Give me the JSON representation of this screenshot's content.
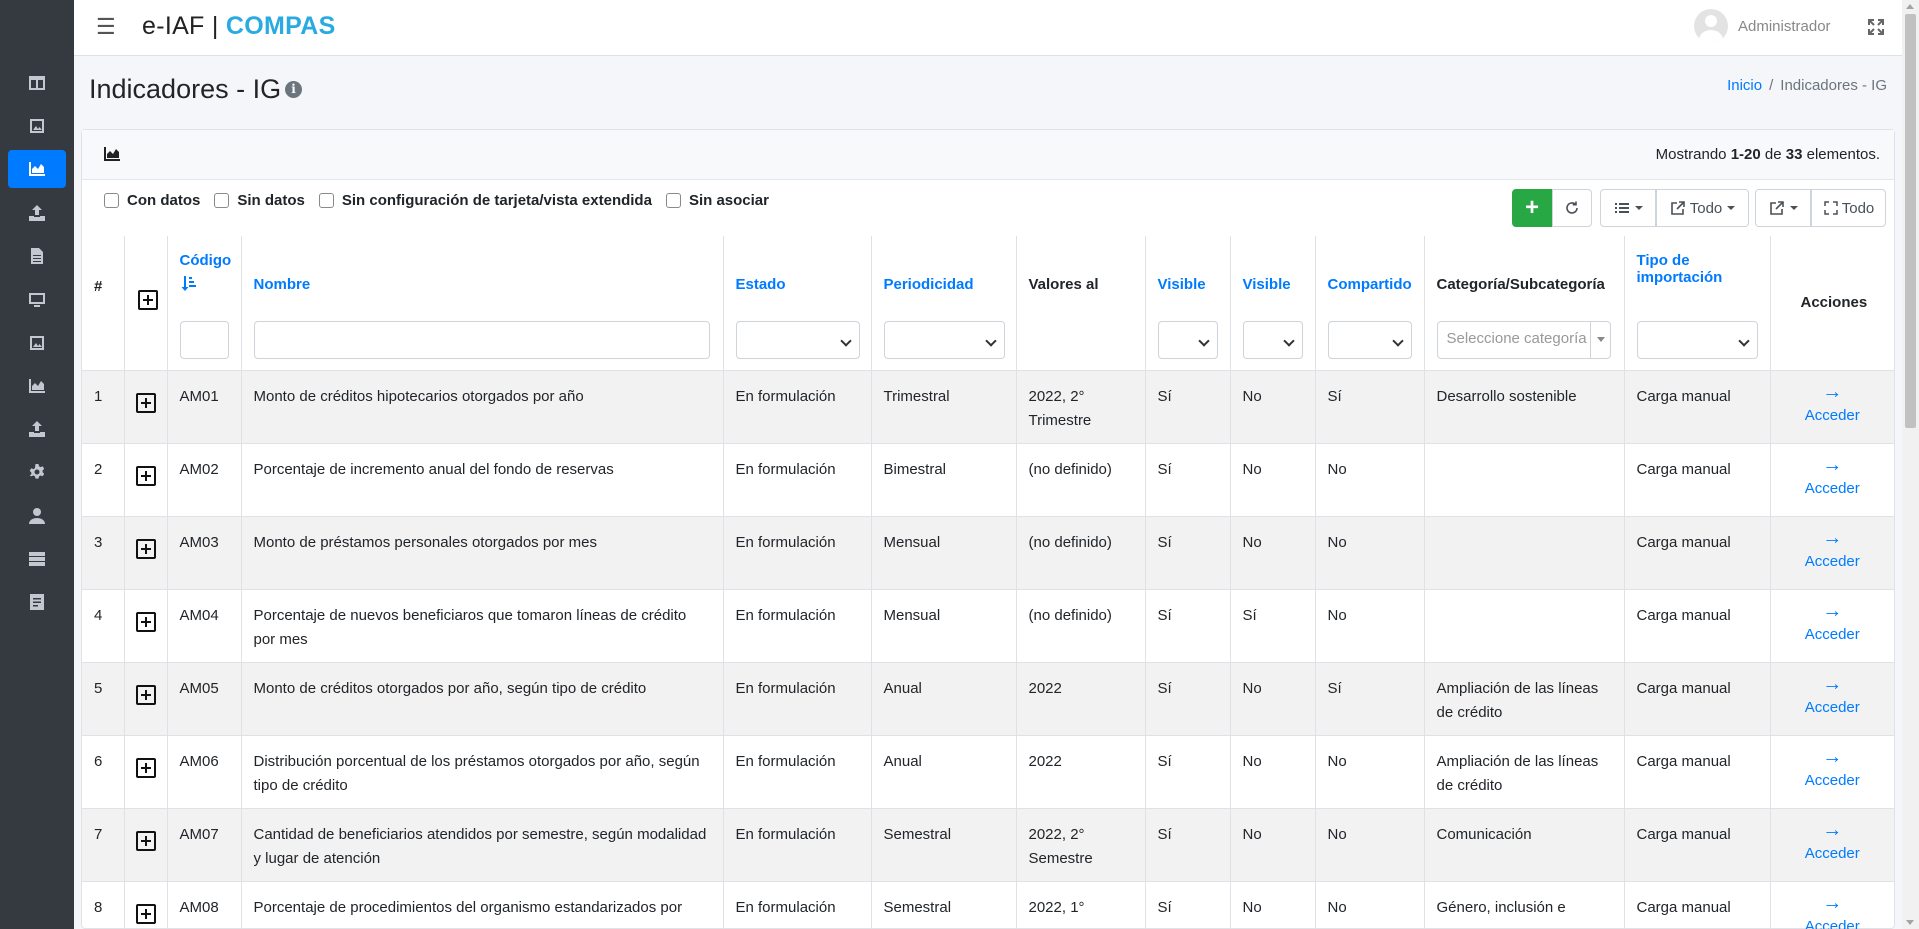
{
  "app": {
    "brand_prefix": "e-IAF |",
    "brand_name": "COMPAS",
    "user_name": "Administrador"
  },
  "sidebar": {
    "items": [
      {
        "icon": "columns-icon"
      },
      {
        "icon": "image-frame-icon"
      },
      {
        "icon": "area-chart-icon",
        "active": true
      },
      {
        "icon": "upload-icon"
      },
      {
        "icon": "document-icon"
      },
      {
        "icon": "monitor-icon"
      },
      {
        "icon": "image-frame-icon"
      },
      {
        "icon": "area-chart-icon"
      },
      {
        "icon": "upload-icon"
      },
      {
        "icon": "gear-icon"
      },
      {
        "icon": "user-icon"
      },
      {
        "icon": "server-icon"
      },
      {
        "icon": "form-icon"
      }
    ]
  },
  "page": {
    "title": "Indicadores - IG",
    "breadcrumb": {
      "home": "Inicio",
      "separator": "/",
      "current": "Indicadores - IG"
    }
  },
  "card": {
    "summary_prefix": "Mostrando ",
    "summary_range": "1-20",
    "summary_mid": " de ",
    "summary_total": "33",
    "summary_suffix": " elementos."
  },
  "filters": [
    {
      "label": "Con datos",
      "checked": false
    },
    {
      "label": "Sin datos",
      "checked": false
    },
    {
      "label": "Sin configuración de tarjeta/vista extendida",
      "checked": false
    },
    {
      "label": "Sin asociar",
      "checked": false
    }
  ],
  "toolbar": {
    "add_label": "+",
    "export_label": "Todo",
    "all_label": "Todo"
  },
  "table": {
    "headers": {
      "num": "#",
      "codigo": "Código",
      "nombre": "Nombre",
      "estado": "Estado",
      "periodicidad": "Periodicidad",
      "valores": "Valores al",
      "visible1": "Visible",
      "visible2": "Visible",
      "compartido": "Compartido",
      "categoria": "Categoría/Subcategoría",
      "tipo_line1": "Tipo de",
      "tipo_line2": "importación",
      "acciones": "Acciones"
    },
    "category_placeholder": "Seleccione categoría",
    "action_label": "Acceder",
    "rows": [
      {
        "num": "1",
        "code": "AM01",
        "name": "Monto de créditos hipotecarios otorgados por año",
        "estado": "En formulación",
        "periodicidad": "Trimestral",
        "valores": "2022, 2° Trimestre",
        "vis1": "Sí",
        "vis2": "No",
        "compartido": "Sí",
        "categoria": "Desarrollo sostenible",
        "tipo": "Carga manual"
      },
      {
        "num": "2",
        "code": "AM02",
        "name": "Porcentaje de incremento anual del fondo de reservas",
        "estado": "En formulación",
        "periodicidad": "Bimestral",
        "valores": "(no definido)",
        "vis1": "Sí",
        "vis2": "No",
        "compartido": "No",
        "categoria": "",
        "tipo": "Carga manual"
      },
      {
        "num": "3",
        "code": "AM03",
        "name": "Monto de préstamos personales otorgados por mes",
        "estado": "En formulación",
        "periodicidad": "Mensual",
        "valores": "(no definido)",
        "vis1": "Sí",
        "vis2": "No",
        "compartido": "No",
        "categoria": "",
        "tipo": "Carga manual"
      },
      {
        "num": "4",
        "code": "AM04",
        "name": "Porcentaje de nuevos beneficiaros que tomaron líneas de crédito por mes",
        "estado": "En formulación",
        "periodicidad": "Mensual",
        "valores": "(no definido)",
        "vis1": "Sí",
        "vis2": "Sí",
        "compartido": "No",
        "categoria": "",
        "tipo": "Carga manual"
      },
      {
        "num": "5",
        "code": "AM05",
        "name": "Monto de créditos otorgados por año, según tipo de crédito",
        "estado": "En formulación",
        "periodicidad": "Anual",
        "valores": "2022",
        "vis1": "Sí",
        "vis2": "No",
        "compartido": "Sí",
        "categoria": "Ampliación de las líneas de crédito",
        "tipo": "Carga manual"
      },
      {
        "num": "6",
        "code": "AM06",
        "name": "Distribución porcentual de los préstamos otorgados por año, según tipo de crédito",
        "estado": "En formulación",
        "periodicidad": "Anual",
        "valores": "2022",
        "vis1": "Sí",
        "vis2": "No",
        "compartido": "No",
        "categoria": "Ampliación de las líneas de crédito",
        "tipo": "Carga manual"
      },
      {
        "num": "7",
        "code": "AM07",
        "name": "Cantidad de beneficiarios atendidos por semestre, según modalidad y lugar de atención",
        "estado": "En formulación",
        "periodicidad": "Semestral",
        "valores": "2022, 2° Semestre",
        "vis1": "Sí",
        "vis2": "No",
        "compartido": "No",
        "categoria": "Comunicación",
        "tipo": "Carga manual"
      },
      {
        "num": "8",
        "code": "AM08",
        "name": "Porcentaje de procedimientos del organismo estandarizados por",
        "estado": "En formulación",
        "periodicidad": "Semestral",
        "valores": "2022, 1°",
        "vis1": "Sí",
        "vis2": "No",
        "compartido": "No",
        "categoria": "Género, inclusión e",
        "tipo": "Carga manual"
      }
    ]
  },
  "colors": {
    "sidebar_bg": "#343a40",
    "accent": "#007bff",
    "add_button": "#28a745",
    "brand_compas": "#29abe2"
  }
}
